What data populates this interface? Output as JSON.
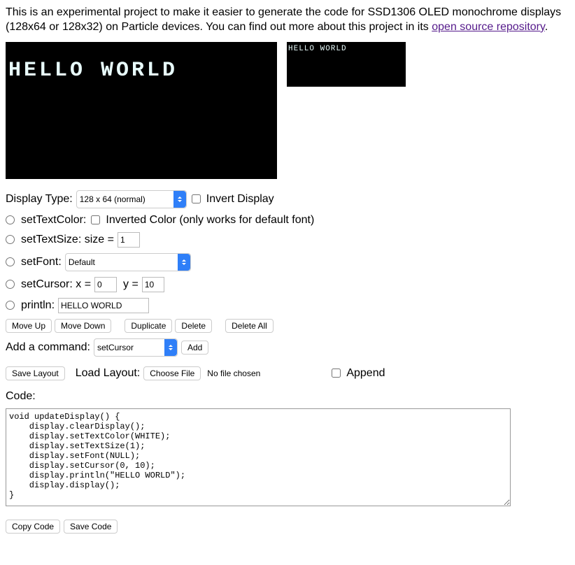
{
  "intro": {
    "text1": "This is an experimental project to make it easier to generate the code for SSD1306 OLED monochrome displays (128x64 or 128x32) on Particle devices. You can find out more about this project in its ",
    "link": "open source repository",
    "text2": "."
  },
  "preview": {
    "large_text": "HELLO WORLD",
    "small_text": "HELLO WORLD"
  },
  "display_type": {
    "label": "Display Type:",
    "selected": "128 x 64 (normal)",
    "invert_label": "Invert Display"
  },
  "commands": {
    "setTextColor": {
      "label": "setTextColor:",
      "inverted_label": "Inverted Color (only works for default font)"
    },
    "setTextSize": {
      "label": "setTextSize: size =",
      "value": "1"
    },
    "setFont": {
      "label": "setFont:",
      "selected": "Default"
    },
    "setCursor": {
      "label": "setCursor: x =",
      "x": "0",
      "ylabel": "y =",
      "y": "10"
    },
    "println": {
      "label": "println:",
      "value": "HELLO WORLD"
    }
  },
  "buttons": {
    "move_up": "Move Up",
    "move_down": "Move Down",
    "duplicate": "Duplicate",
    "delete": "Delete",
    "delete_all": "Delete All",
    "add": "Add",
    "save_layout": "Save Layout",
    "choose_file": "Choose File",
    "copy_code": "Copy Code",
    "save_code": "Save Code"
  },
  "add_command": {
    "label": "Add a command:",
    "selected": "setCursor"
  },
  "load_layout": {
    "label": "Load Layout:",
    "nofile": "No file chosen",
    "append_label": "Append"
  },
  "code": {
    "label": "Code:",
    "content": "void updateDisplay() {\n    display.clearDisplay();\n    display.setTextColor(WHITE);\n    display.setTextSize(1);\n    display.setFont(NULL);\n    display.setCursor(0, 10);\n    display.println(\"HELLO WORLD\");\n    display.display();\n}"
  }
}
